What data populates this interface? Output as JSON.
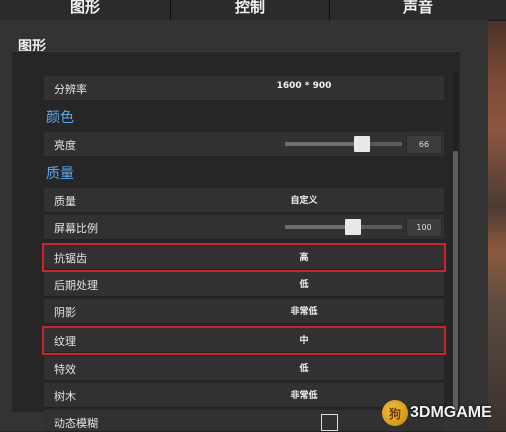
{
  "tabs": [
    {
      "label": "图形"
    },
    {
      "label": "控制"
    },
    {
      "label": "声音"
    }
  ],
  "panel": {
    "title": "图形"
  },
  "rows": {
    "resolution": {
      "label": "分辨率",
      "value": "1600 * 900"
    },
    "section_color": "颜色",
    "brightness": {
      "label": "亮度",
      "value": "66",
      "level_percent": 66
    },
    "section_quality": "质量",
    "quality": {
      "label": "质量",
      "value": "自定义"
    },
    "screen_scale": {
      "label": "屏幕比例",
      "value": "100",
      "level_percent": 58
    },
    "antialiasing": {
      "label": "抗锯齿",
      "value": "高"
    },
    "post_processing": {
      "label": "后期处理",
      "value": "低"
    },
    "shadows": {
      "label": "阴影",
      "value": "非常低"
    },
    "textures": {
      "label": "纹理",
      "value": "中"
    },
    "effects": {
      "label": "特效",
      "value": "低"
    },
    "foliage": {
      "label": "树木",
      "value": "非常低"
    },
    "motion_blur": {
      "label": "动态模糊",
      "checked": false
    }
  },
  "watermark": {
    "text": "3DMGAME",
    "logo": "狗"
  },
  "colors": {
    "highlight": "#c9262c",
    "section": "#5fa6ea"
  }
}
